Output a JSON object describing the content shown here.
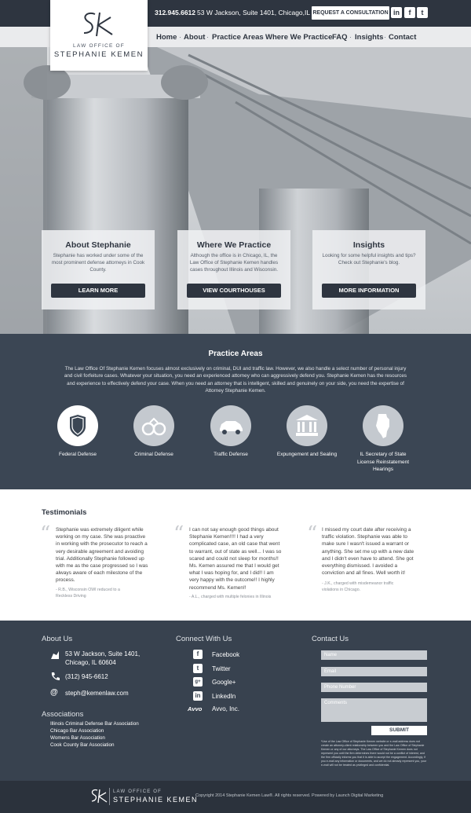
{
  "header": {
    "phone": "312.945.6612",
    "address": "53 W Jackson, Suite 1401, Chicago,IL",
    "consult_label": "REQUEST A CONSULTATION",
    "logo_mark": "SK",
    "logo_line1": "LAW OFFICE OF",
    "logo_line2": "STEPHANIE KEMEN",
    "social": [
      {
        "label": "in",
        "icon": "linkedin-icon"
      },
      {
        "label": "f",
        "icon": "facebook-icon"
      },
      {
        "label": "t",
        "icon": "twitter-icon"
      }
    ]
  },
  "nav": {
    "items": [
      "Home",
      "About",
      "Practice Areas",
      "Where We Practice",
      "FAQ",
      "Insights",
      "Contact"
    ]
  },
  "cards": [
    {
      "title": "About Stephanie",
      "desc": "Stephanie has worked under some of the most prominent defense attorneys in Cook County.",
      "button": "LEARN MORE"
    },
    {
      "title": "Where We Practice",
      "desc": "Although the office is in Chicago, IL, the Law Office of Stephanie Kemen handles cases throughout Illinois and Wisconsin.",
      "button": "VIEW COURTHOUSES"
    },
    {
      "title": "Insights",
      "desc": "Looking for some helpful insights and tips? Check out Stephanie's blog.",
      "button": "MORE INFORMATION"
    }
  ],
  "practice": {
    "title": "Practice Areas",
    "desc": "The Law Office Of Stephanie Kemen focuses almost exclusively on criminal, DUI and traffic law. However, we also handle a select number of personal injury and civil forfeiture cases. Whatever your situation, you need an experienced attorney who can aggressively defend you. Stephanie Kemen has the resources and experience to effectively defend your case. When you need an attorney that is intelligent, skilled and genuinely on your side, you need the expertise of Attorney Stephanie Kemen.",
    "areas": [
      {
        "label": "Federal Defense",
        "icon": "shield-icon"
      },
      {
        "label": "Criminal Defense",
        "icon": "handcuffs-icon"
      },
      {
        "label": "Traffic Defense",
        "icon": "car-icon"
      },
      {
        "label": "Expungement and Sealing",
        "icon": "courthouse-icon"
      },
      {
        "label": "IL Secretary of State License Reinstatement Hearings",
        "icon": "illinois-icon"
      }
    ]
  },
  "testimonials": {
    "title": "Testimonials",
    "items": [
      {
        "quote": "Stephanie was extremely diligent while working on my case. She was proactive in working with the prosecutor to reach a very desirable agreement and avoiding trial. Additionally Stephanie followed up with me as the case progressed so I was always aware of each milestone of the process.",
        "source": "- R.B., Wisconsin OWI reduced to a Reckless Driving"
      },
      {
        "quote": "I can not say enough good things about Stephanie Kemen!!!! I had a very complicated case, an old case that went to warrant, out of state as well... I was so scared and could not sleep for months!! Ms. Kemen assured me that I would get what I was hoping for, and I did!! I am very happy with the outcome!! I highly recommend Ms. Kemen!!",
        "source": "- A.L., charged with multiple felonies in Illinois"
      },
      {
        "quote": "I missed my court date after receiving a traffic violation. Stephanie was able to make sure I wasn't issued a warrant or anything. She set me up with a new date and I didn't even have to attend. She got everything dismissed. I avoided a conviction and all fines. Well worth it!",
        "source": "- J.K., charged with misdemeanor traffic violations in Chicago."
      }
    ]
  },
  "footer": {
    "about_title": "About Us",
    "address1": "53 W Jackson, Suite 1401,",
    "address2": "Chicago, IL 60604",
    "phone": "(312) 945-6612",
    "email": "steph@kemenlaw.com",
    "assoc_title": "Associations",
    "associations": [
      "Illinois Criminal Defense Bar Association",
      "Chicago Bar Association",
      "Womens Bar Association",
      "Cook County Bar Association"
    ],
    "connect_title": "Connect With Us",
    "connect": [
      {
        "label": "Facebook",
        "icon": "facebook-icon",
        "glyph": "f"
      },
      {
        "label": "Twitter",
        "icon": "twitter-icon",
        "glyph": "t"
      },
      {
        "label": "Google+",
        "icon": "googleplus-icon",
        "glyph": "g+"
      },
      {
        "label": "LinkedIn",
        "icon": "linkedin-icon",
        "glyph": "in"
      },
      {
        "label": "Avvo, Inc.",
        "icon": "avvo-icon",
        "glyph": "Avvo"
      }
    ],
    "contact_title": "Contact Us",
    "form": {
      "name": "Name",
      "email": "Email",
      "phone": "Phone Number",
      "comments": "Comments",
      "submit": "SUBMIT"
    },
    "disclaimer": "*Use of the Law Office of Stephanie Kemen website or e-mail address does not create an attorney-client relationship between you and the Law Office of Stephanie Kemen or any of our attorneys. The Law Office of Stephanie Kemen does not represent you until the firm determines there would not be a conflict of interest, and the firm officially informs you that it is able to accept the engagement. Accordingly, if you e-mail any information or documents, and we do not already represent you, your e-mail will not be treated as privileged and confidential."
  },
  "bottom": {
    "copyright": "Copyright 2014 Stephanie Kemen Law®. All rights reserved. Powered by Launch Digital Marketing",
    "logo_line1": "LAW OFFICE OF",
    "logo_line2": "STEPHANIE KEMEN"
  },
  "colors": {
    "primary": "#2e3540",
    "practice_bg": "#3b4654",
    "footer_bg": "#38424f"
  }
}
